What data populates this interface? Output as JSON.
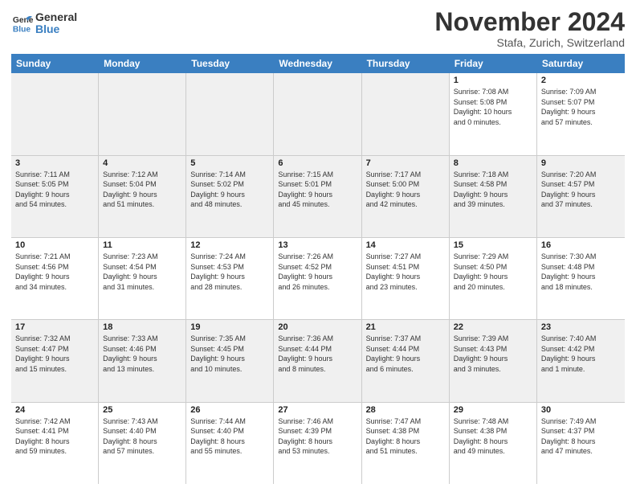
{
  "logo": {
    "line1": "General",
    "line2": "Blue"
  },
  "title": "November 2024",
  "location": "Stafa, Zurich, Switzerland",
  "weekdays": [
    "Sunday",
    "Monday",
    "Tuesday",
    "Wednesday",
    "Thursday",
    "Friday",
    "Saturday"
  ],
  "weeks": [
    [
      {
        "day": "",
        "info": ""
      },
      {
        "day": "",
        "info": ""
      },
      {
        "day": "",
        "info": ""
      },
      {
        "day": "",
        "info": ""
      },
      {
        "day": "",
        "info": ""
      },
      {
        "day": "1",
        "info": "Sunrise: 7:08 AM\nSunset: 5:08 PM\nDaylight: 10 hours\nand 0 minutes."
      },
      {
        "day": "2",
        "info": "Sunrise: 7:09 AM\nSunset: 5:07 PM\nDaylight: 9 hours\nand 57 minutes."
      }
    ],
    [
      {
        "day": "3",
        "info": "Sunrise: 7:11 AM\nSunset: 5:05 PM\nDaylight: 9 hours\nand 54 minutes."
      },
      {
        "day": "4",
        "info": "Sunrise: 7:12 AM\nSunset: 5:04 PM\nDaylight: 9 hours\nand 51 minutes."
      },
      {
        "day": "5",
        "info": "Sunrise: 7:14 AM\nSunset: 5:02 PM\nDaylight: 9 hours\nand 48 minutes."
      },
      {
        "day": "6",
        "info": "Sunrise: 7:15 AM\nSunset: 5:01 PM\nDaylight: 9 hours\nand 45 minutes."
      },
      {
        "day": "7",
        "info": "Sunrise: 7:17 AM\nSunset: 5:00 PM\nDaylight: 9 hours\nand 42 minutes."
      },
      {
        "day": "8",
        "info": "Sunrise: 7:18 AM\nSunset: 4:58 PM\nDaylight: 9 hours\nand 39 minutes."
      },
      {
        "day": "9",
        "info": "Sunrise: 7:20 AM\nSunset: 4:57 PM\nDaylight: 9 hours\nand 37 minutes."
      }
    ],
    [
      {
        "day": "10",
        "info": "Sunrise: 7:21 AM\nSunset: 4:56 PM\nDaylight: 9 hours\nand 34 minutes."
      },
      {
        "day": "11",
        "info": "Sunrise: 7:23 AM\nSunset: 4:54 PM\nDaylight: 9 hours\nand 31 minutes."
      },
      {
        "day": "12",
        "info": "Sunrise: 7:24 AM\nSunset: 4:53 PM\nDaylight: 9 hours\nand 28 minutes."
      },
      {
        "day": "13",
        "info": "Sunrise: 7:26 AM\nSunset: 4:52 PM\nDaylight: 9 hours\nand 26 minutes."
      },
      {
        "day": "14",
        "info": "Sunrise: 7:27 AM\nSunset: 4:51 PM\nDaylight: 9 hours\nand 23 minutes."
      },
      {
        "day": "15",
        "info": "Sunrise: 7:29 AM\nSunset: 4:50 PM\nDaylight: 9 hours\nand 20 minutes."
      },
      {
        "day": "16",
        "info": "Sunrise: 7:30 AM\nSunset: 4:48 PM\nDaylight: 9 hours\nand 18 minutes."
      }
    ],
    [
      {
        "day": "17",
        "info": "Sunrise: 7:32 AM\nSunset: 4:47 PM\nDaylight: 9 hours\nand 15 minutes."
      },
      {
        "day": "18",
        "info": "Sunrise: 7:33 AM\nSunset: 4:46 PM\nDaylight: 9 hours\nand 13 minutes."
      },
      {
        "day": "19",
        "info": "Sunrise: 7:35 AM\nSunset: 4:45 PM\nDaylight: 9 hours\nand 10 minutes."
      },
      {
        "day": "20",
        "info": "Sunrise: 7:36 AM\nSunset: 4:44 PM\nDaylight: 9 hours\nand 8 minutes."
      },
      {
        "day": "21",
        "info": "Sunrise: 7:37 AM\nSunset: 4:44 PM\nDaylight: 9 hours\nand 6 minutes."
      },
      {
        "day": "22",
        "info": "Sunrise: 7:39 AM\nSunset: 4:43 PM\nDaylight: 9 hours\nand 3 minutes."
      },
      {
        "day": "23",
        "info": "Sunrise: 7:40 AM\nSunset: 4:42 PM\nDaylight: 9 hours\nand 1 minute."
      }
    ],
    [
      {
        "day": "24",
        "info": "Sunrise: 7:42 AM\nSunset: 4:41 PM\nDaylight: 8 hours\nand 59 minutes."
      },
      {
        "day": "25",
        "info": "Sunrise: 7:43 AM\nSunset: 4:40 PM\nDaylight: 8 hours\nand 57 minutes."
      },
      {
        "day": "26",
        "info": "Sunrise: 7:44 AM\nSunset: 4:40 PM\nDaylight: 8 hours\nand 55 minutes."
      },
      {
        "day": "27",
        "info": "Sunrise: 7:46 AM\nSunset: 4:39 PM\nDaylight: 8 hours\nand 53 minutes."
      },
      {
        "day": "28",
        "info": "Sunrise: 7:47 AM\nSunset: 4:38 PM\nDaylight: 8 hours\nand 51 minutes."
      },
      {
        "day": "29",
        "info": "Sunrise: 7:48 AM\nSunset: 4:38 PM\nDaylight: 8 hours\nand 49 minutes."
      },
      {
        "day": "30",
        "info": "Sunrise: 7:49 AM\nSunset: 4:37 PM\nDaylight: 8 hours\nand 47 minutes."
      }
    ]
  ]
}
